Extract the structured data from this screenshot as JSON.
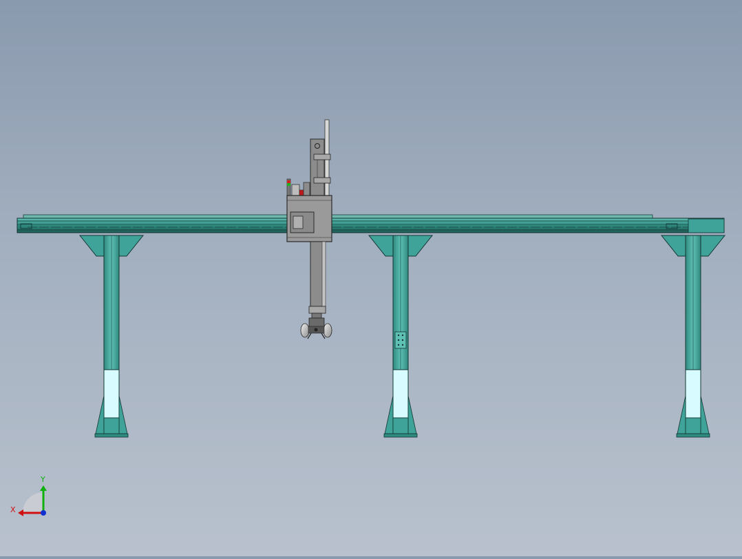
{
  "triad": {
    "x_label": "X",
    "y_label": "Y"
  },
  "colors": {
    "background_top": "#8a9aae",
    "background_bottom": "#b8c1cd",
    "frame_teal": "#3fa399",
    "frame_dark": "#1f5d57",
    "leg_highlight": "#d8fbff",
    "carriage_gray": "#9a9a9a",
    "carriage_dark": "#4a4a4a",
    "axis_x": "#d01010",
    "axis_y": "#10b010",
    "axis_z": "#1030d0"
  }
}
